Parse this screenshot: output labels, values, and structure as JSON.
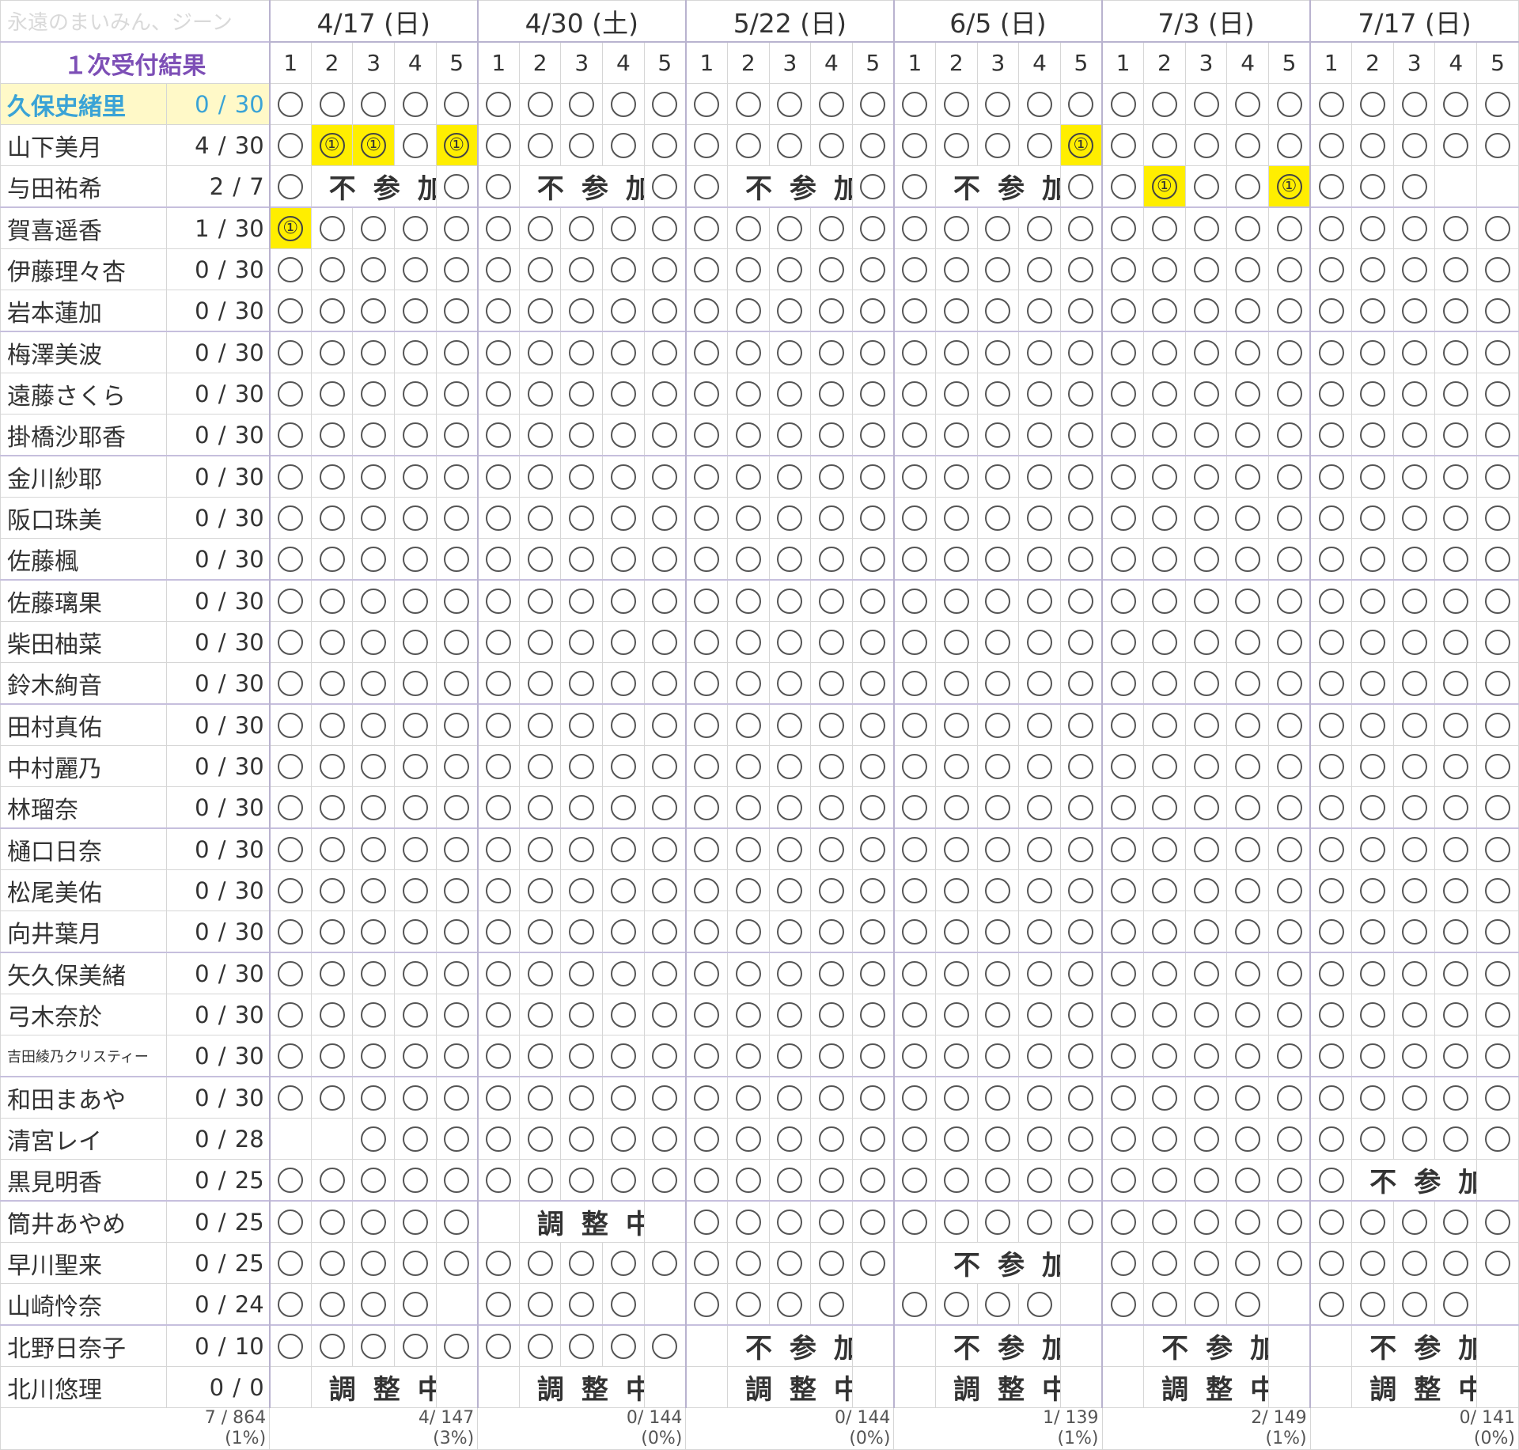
{
  "watermark": "永遠のまいみん、ジーン",
  "result_title": "１次受付結果",
  "dates": [
    "4/17 (日)",
    "4/30 (土)",
    "5/22 (日)",
    "6/5 (日)",
    "7/3 (日)",
    "7/17 (日)"
  ],
  "slot_numbers": [
    "1",
    "2",
    "3",
    "4",
    "5"
  ],
  "rows": [
    {
      "name": "久保史緒里",
      "count": "0 / 30",
      "cells": "oooooooooooooooooooooooooooooo"
    },
    {
      "name": "山下美月",
      "count": "4 / 30",
      "cells": "o11o1oooooooooooooo1oooooooooo"
    },
    {
      "name": "与田祐希",
      "count": "2 / 7",
      "cells": "ooooooooooooooooooooo1oo1ooo..",
      "spans": [
        {
          "start": 1,
          "len": 3,
          "text": "不参加"
        },
        {
          "start": 6,
          "len": 3,
          "text": "不参加"
        },
        {
          "start": 11,
          "len": 3,
          "text": "不参加"
        },
        {
          "start": 16,
          "len": 3,
          "text": "不参加"
        }
      ]
    },
    {
      "name": "賀喜遥香",
      "count": "1 / 30",
      "cells": "1ooooooooooooooooooooooooooooo"
    },
    {
      "name": "伊藤理々杏",
      "count": "0 / 30",
      "cells": "oooooooooooooooooooooooooooooo"
    },
    {
      "name": "岩本蓮加",
      "count": "0 / 30",
      "cells": "oooooooooooooooooooooooooooooo"
    },
    {
      "name": "梅澤美波",
      "count": "0 / 30",
      "cells": "oooooooooooooooooooooooooooooo"
    },
    {
      "name": "遠藤さくら",
      "count": "0 / 30",
      "cells": "oooooooooooooooooooooooooooooo"
    },
    {
      "name": "掛橋沙耶香",
      "count": "0 / 30",
      "cells": "oooooooooooooooooooooooooooooo"
    },
    {
      "name": "金川紗耶",
      "count": "0 / 30",
      "cells": "oooooooooooooooooooooooooooooo"
    },
    {
      "name": "阪口珠美",
      "count": "0 / 30",
      "cells": "oooooooooooooooooooooooooooooo"
    },
    {
      "name": "佐藤楓",
      "count": "0 / 30",
      "cells": "oooooooooooooooooooooooooooooo"
    },
    {
      "name": "佐藤璃果",
      "count": "0 / 30",
      "cells": "oooooooooooooooooooooooooooooo"
    },
    {
      "name": "柴田柚菜",
      "count": "0 / 30",
      "cells": "oooooooooooooooooooooooooooooo"
    },
    {
      "name": "鈴木絢音",
      "count": "0 / 30",
      "cells": "oooooooooooooooooooooooooooooo"
    },
    {
      "name": "田村真佑",
      "count": "0 / 30",
      "cells": "oooooooooooooooooooooooooooooo"
    },
    {
      "name": "中村麗乃",
      "count": "0 / 30",
      "cells": "oooooooooooooooooooooooooooooo"
    },
    {
      "name": "林瑠奈",
      "count": "0 / 30",
      "cells": "oooooooooooooooooooooooooooooo"
    },
    {
      "name": "樋口日奈",
      "count": "0 / 30",
      "cells": "oooooooooooooooooooooooooooooo"
    },
    {
      "name": "松尾美佑",
      "count": "0 / 30",
      "cells": "oooooooooooooooooooooooooooooo"
    },
    {
      "name": "向井葉月",
      "count": "0 / 30",
      "cells": "oooooooooooooooooooooooooooooo"
    },
    {
      "name": "矢久保美緒",
      "count": "0 / 30",
      "cells": "oooooooooooooooooooooooooooooo"
    },
    {
      "name": "弓木奈於",
      "count": "0 / 30",
      "cells": "oooooooooooooooooooooooooooooo"
    },
    {
      "name": "吉田綾乃クリスティー",
      "count": "0 / 30",
      "cells": "oooooooooooooooooooooooooooooo",
      "small": true
    },
    {
      "name": "和田まあや",
      "count": "0 / 30",
      "cells": "oooooooooooooooooooooooooooooo"
    },
    {
      "name": "清宮レイ",
      "count": "0 / 28",
      "cells": "..oooooooooooooooooooooooooooo"
    },
    {
      "name": "黒見明香",
      "count": "0 / 25",
      "cells": "ooooooooooooooooooooooooooooo.",
      "spans": [
        {
          "start": 26,
          "len": 3,
          "text": "不参加"
        }
      ]
    },
    {
      "name": "筒井あやめ",
      "count": "0 / 25",
      "cells": "ooooo.....oooooooooooooooooooo",
      "spans": [
        {
          "start": 6,
          "len": 3,
          "text": "調整中"
        }
      ]
    },
    {
      "name": "早川聖来",
      "count": "0 / 25",
      "cells": "ooooooooooooooo.....oooooooooo",
      "spans": [
        {
          "start": 16,
          "len": 3,
          "text": "不参加"
        }
      ]
    },
    {
      "name": "山崎怜奈",
      "count": "0 / 24",
      "cells": "oooo.oooo.oooo.oooo.oooo.oooo."
    },
    {
      "name": "北野日奈子",
      "count": "0 / 10",
      "cells": "oooooooooo....................",
      "spans": [
        {
          "start": 11,
          "len": 3,
          "text": "不参加"
        },
        {
          "start": 16,
          "len": 3,
          "text": "不参加"
        },
        {
          "start": 21,
          "len": 3,
          "text": "不参加"
        },
        {
          "start": 26,
          "len": 3,
          "text": "不参加"
        }
      ]
    },
    {
      "name": "北川悠理",
      "count": "0 / 0",
      "cells": "..............................",
      "spans": [
        {
          "start": 1,
          "len": 3,
          "text": "調整中"
        },
        {
          "start": 6,
          "len": 3,
          "text": "調整中"
        },
        {
          "start": 11,
          "len": 3,
          "text": "調整中"
        },
        {
          "start": 16,
          "len": 3,
          "text": "調整中"
        },
        {
          "start": 21,
          "len": 3,
          "text": "調整中"
        },
        {
          "start": 26,
          "len": 3,
          "text": "調整中"
        }
      ]
    }
  ],
  "hit_marker": "①",
  "totals": {
    "overall": {
      "value": "7 / 864",
      "pct": "(1%)"
    },
    "per_date": [
      {
        "value": "4/ 147",
        "pct": "(3%)"
      },
      {
        "value": "0/ 144",
        "pct": "(0%)"
      },
      {
        "value": "0/ 144",
        "pct": "(0%)"
      },
      {
        "value": "1/ 139",
        "pct": "(1%)"
      },
      {
        "value": "2/ 149",
        "pct": "(1%)"
      },
      {
        "value": "0/ 141",
        "pct": "(0%)"
      }
    ]
  }
}
